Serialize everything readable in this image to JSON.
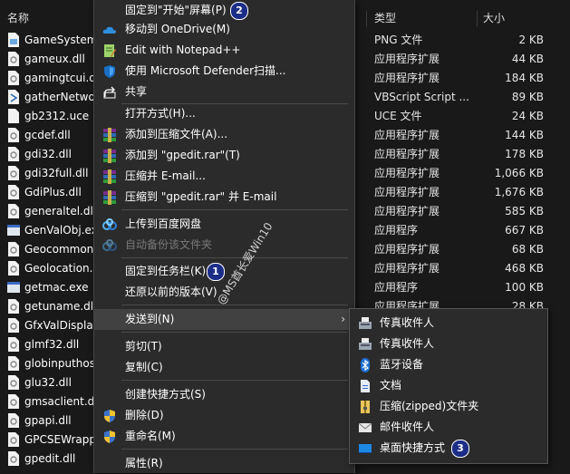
{
  "columns": {
    "name": "名称",
    "type": "类型",
    "size": "大小"
  },
  "files": [
    {
      "name": "GameSystem",
      "type": "PNG 文件",
      "size": "2 KB",
      "icon": "png-file-icon"
    },
    {
      "name": "gameux.dll",
      "type": "应用程序扩展",
      "size": "44 KB",
      "icon": "dll-file-icon"
    },
    {
      "name": "gamingtcui.d",
      "type": "应用程序扩展",
      "size": "184 KB",
      "icon": "dll-file-icon"
    },
    {
      "name": "gatherNetwo",
      "type": "VBScript Script ...",
      "size": "89 KB",
      "icon": "vbs-file-icon"
    },
    {
      "name": "gb2312.uce",
      "type": "UCE 文件",
      "size": "24 KB",
      "icon": "blank-file-icon"
    },
    {
      "name": "gcdef.dll",
      "type": "应用程序扩展",
      "size": "144 KB",
      "icon": "dll-file-icon"
    },
    {
      "name": "gdi32.dll",
      "type": "应用程序扩展",
      "size": "178 KB",
      "icon": "dll-file-icon"
    },
    {
      "name": "gdi32full.dll",
      "type": "应用程序扩展",
      "size": "1,066 KB",
      "icon": "dll-file-icon"
    },
    {
      "name": "GdiPlus.dll",
      "type": "应用程序扩展",
      "size": "1,676 KB",
      "icon": "dll-file-icon"
    },
    {
      "name": "generaltel.dll",
      "type": "应用程序扩展",
      "size": "585 KB",
      "icon": "dll-file-icon"
    },
    {
      "name": "GenValObj.ex",
      "type": "应用程序",
      "size": "667 KB",
      "icon": "exe-file-icon"
    },
    {
      "name": "Geocommon",
      "type": "应用程序扩展",
      "size": "68 KB",
      "icon": "dll-file-icon"
    },
    {
      "name": "Geolocation.",
      "type": "应用程序扩展",
      "size": "468 KB",
      "icon": "dll-file-icon"
    },
    {
      "name": "getmac.exe",
      "type": "应用程序",
      "size": "100 KB",
      "icon": "exe-file-icon"
    },
    {
      "name": "getuname.dll",
      "type": "应用程序扩展",
      "size": "28 KB",
      "icon": "dll-file-icon"
    },
    {
      "name": "GfxValDispla",
      "type": "",
      "size": "",
      "icon": "dll-file-icon"
    },
    {
      "name": "glmf32.dll",
      "type": "",
      "size": "",
      "icon": "dll-file-icon"
    },
    {
      "name": "globinputhos",
      "type": "",
      "size": "",
      "icon": "dll-file-icon"
    },
    {
      "name": "glu32.dll",
      "type": "",
      "size": "",
      "icon": "dll-file-icon"
    },
    {
      "name": "gmsaclient.d",
      "type": "",
      "size": "",
      "icon": "dll-file-icon"
    },
    {
      "name": "gpapi.dll",
      "type": "",
      "size": "",
      "icon": "dll-file-icon"
    },
    {
      "name": "GPCSEWrapp",
      "type": "",
      "size": "",
      "icon": "dll-file-icon"
    },
    {
      "name": "gpedit.dll",
      "type": "",
      "size": "",
      "icon": "dll-file-icon"
    }
  ],
  "context_menu": {
    "pin_start": "固定到\"开始\"屏幕(P)",
    "move_onedrive": "移动到 OneDrive(M)",
    "edit_notepad": "Edit with Notepad++",
    "defender_scan": "使用 Microsoft Defender扫描...",
    "share": "共享",
    "open_with": "打开方式(H)...",
    "add_archive": "添加到压缩文件(A)...",
    "add_rar": "添加到 \"gpedit.rar\"(T)",
    "compress_email": "压缩并 E-mail...",
    "compress_rar_email": "压缩到 \"gpedit.rar\" 并 E-mail",
    "upload_baidu": "上传到百度网盘",
    "auto_backup": "自动备份该文件夹",
    "pin_taskbar": "固定到任务栏(K)",
    "restore_previous": "还原以前的版本(V)",
    "send_to": "发送到(N)",
    "cut": "剪切(T)",
    "copy": "复制(C)",
    "create_shortcut": "创建快捷方式(S)",
    "delete": "删除(D)",
    "rename": "重命名(M)",
    "properties": "属性(R)"
  },
  "submenu": {
    "fax1": "传真收件人",
    "fax2": "传真收件人",
    "bluetooth": "蓝牙设备",
    "documents": "文档",
    "zip_folder": "压缩(zipped)文件夹",
    "mail": "邮件收件人",
    "desktop_shortcut": "桌面快捷方式"
  },
  "badges": {
    "b1": "1",
    "b2": "2",
    "b3": "3"
  },
  "watermark": "@MS酋长爱Win10",
  "colors": {
    "background": "#191919",
    "menu": "#2b2b2b",
    "badge": "#1b2d86"
  }
}
